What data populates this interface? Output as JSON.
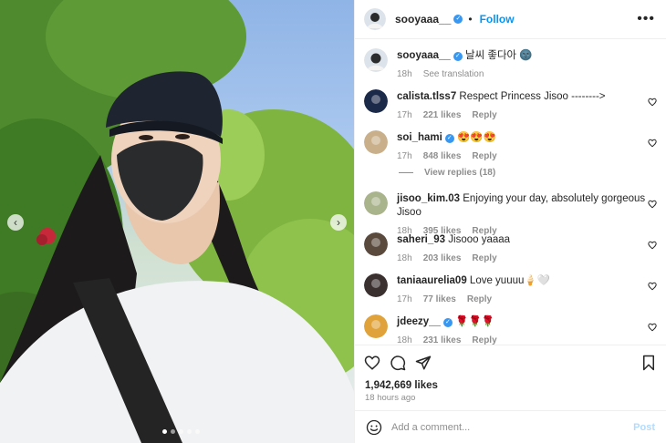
{
  "post": {
    "username": "sooyaaa__",
    "follow_label": "Follow",
    "separator": "•",
    "more_label": "•••",
    "caption_text": "날씨 좋다아 🌚",
    "caption_time": "18h",
    "see_translation": "See translation"
  },
  "carousel": {
    "slide_count": 5,
    "active_index": 0,
    "prev_icon": "chevron-left-icon",
    "next_icon": "chevron-right-icon"
  },
  "comments": [
    {
      "user": "calista.tlss7",
      "verified": false,
      "text": "Respect Princess Jisoo -------->",
      "time": "17h",
      "likes": "221 likes",
      "reply": "Reply",
      "avatar_color": "#1c2a4a"
    },
    {
      "user": "soi_hami",
      "verified": true,
      "text": "😍😍😍",
      "time": "17h",
      "likes": "848 likes",
      "reply": "Reply",
      "avatar_color": "#c9b08a"
    },
    {
      "user": "jisoo_kim.03",
      "verified": false,
      "text": "Enjoying your day, absolutely gorgeous Jisoo",
      "time": "18h",
      "likes": "395 likes",
      "reply": "Reply",
      "avatar_color": "#a9b48c"
    },
    {
      "user": "saheri_93",
      "verified": false,
      "text": "Jisooo yaaaa",
      "time": "18h",
      "likes": "203 likes",
      "reply": "Reply",
      "avatar_color": "#5a4a3e"
    },
    {
      "user": "taniaaurelia09",
      "verified": false,
      "text": "Love yuuuu🍦🤍",
      "time": "17h",
      "likes": "77 likes",
      "reply": "Reply",
      "avatar_color": "#3b3030"
    },
    {
      "user": "jdeezy__",
      "verified": true,
      "text": "🌹🌹🌹",
      "time": "18h",
      "likes": "231 likes",
      "reply": "Reply",
      "avatar_color": "#e0a23a"
    }
  ],
  "view_replies": "View replies (18)",
  "actions": {
    "icons": [
      "heart-icon",
      "comment-icon",
      "share-icon",
      "bookmark-icon"
    ],
    "likes": "1,942,669 likes",
    "time_ago": "18 hours ago"
  },
  "composer": {
    "placeholder": "Add a comment...",
    "post_label": "Post",
    "emoji_icon": "emoji-icon"
  },
  "colors": {
    "accent": "#0095f6",
    "verified": "#3897f0",
    "muted": "#8e8e8e"
  }
}
